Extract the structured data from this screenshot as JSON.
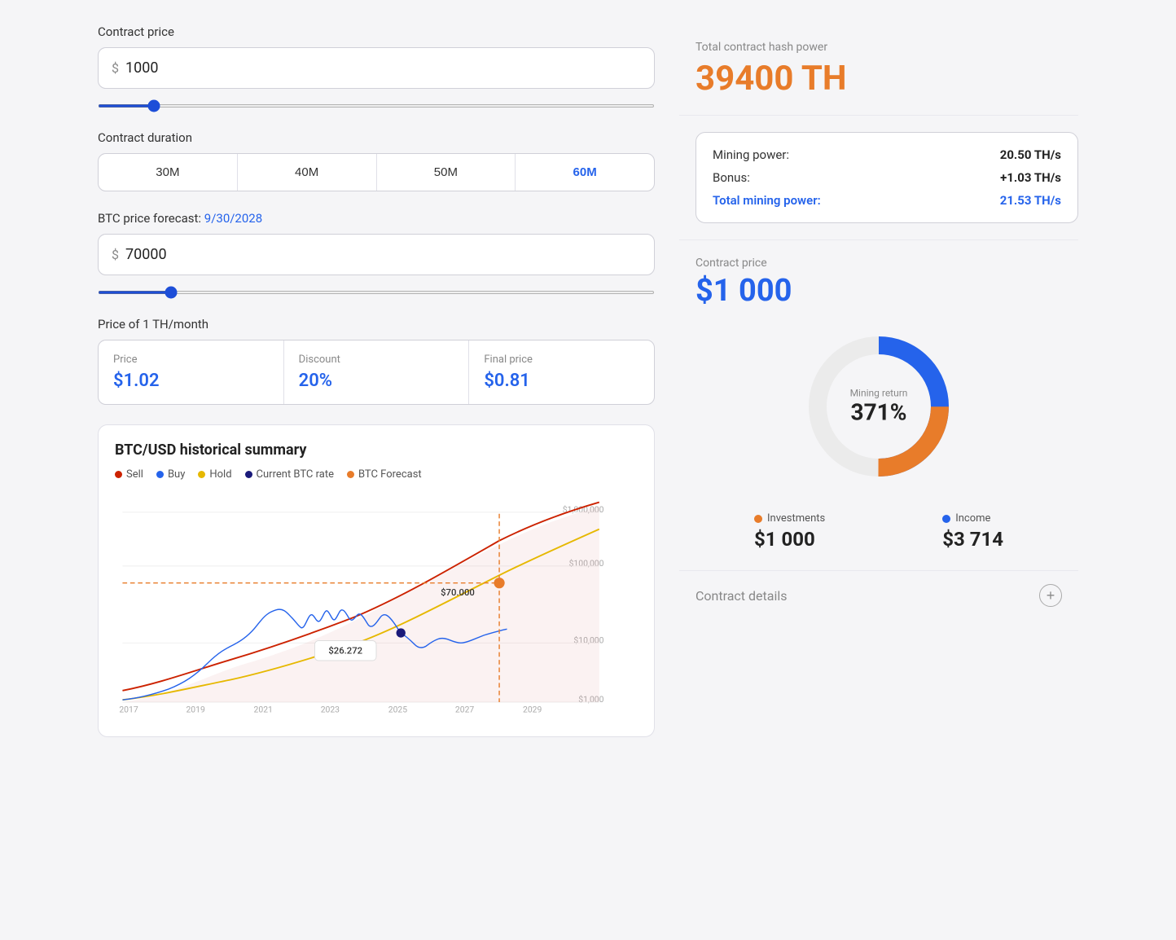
{
  "left": {
    "contract_price_label": "Contract price",
    "contract_price_currency": "$",
    "contract_price_value": "1000",
    "contract_duration_label": "Contract duration",
    "duration_buttons": [
      "30M",
      "40M",
      "50M",
      "60M"
    ],
    "active_duration": "60M",
    "btc_forecast_label": "BTC price forecast:",
    "btc_forecast_date": "9/30/2028",
    "btc_price_currency": "$",
    "btc_price_value": "70000",
    "price_th_label": "Price of 1 TH/month",
    "price_label": "Price",
    "price_value": "$1.02",
    "discount_label": "Discount",
    "discount_value": "20%",
    "final_price_label": "Final price",
    "final_price_value": "$0.81",
    "chart_title": "BTC/USD historical summary",
    "legend": [
      {
        "label": "Sell",
        "color": "#cc2200"
      },
      {
        "label": "Buy",
        "color": "#2563eb"
      },
      {
        "label": "Hold",
        "color": "#e6b800"
      },
      {
        "label": "Current BTC rate",
        "color": "#1a1a7a"
      },
      {
        "label": "BTC Forecast",
        "color": "#e87c2a"
      }
    ],
    "chart_y_labels": [
      "$1,000,000",
      "$100,000",
      "$10,000",
      "$1,000"
    ],
    "chart_x_labels": [
      "2017",
      "2019",
      "2021",
      "2023",
      "2025",
      "2027",
      "2029"
    ],
    "chart_annotation_current": "$26.272",
    "chart_annotation_forecast": "$70.000"
  },
  "right": {
    "hash_power_label": "Total contract hash power",
    "hash_power_value": "39400 TH",
    "mining_power_label": "Mining power:",
    "mining_power_value": "20.50 TH/s",
    "bonus_label": "Bonus:",
    "bonus_value": "+1.03 TH/s",
    "total_mining_label": "Total mining power:",
    "total_mining_value": "21.53 TH/s",
    "contract_price_label": "Contract price",
    "contract_price_value": "$1 000",
    "donut_center_label": "Mining return",
    "donut_center_value": "371%",
    "investments_label": "Investments",
    "investments_value": "$1 000",
    "income_label": "Income",
    "income_value": "$3 714",
    "contract_details_label": "Contract details"
  }
}
